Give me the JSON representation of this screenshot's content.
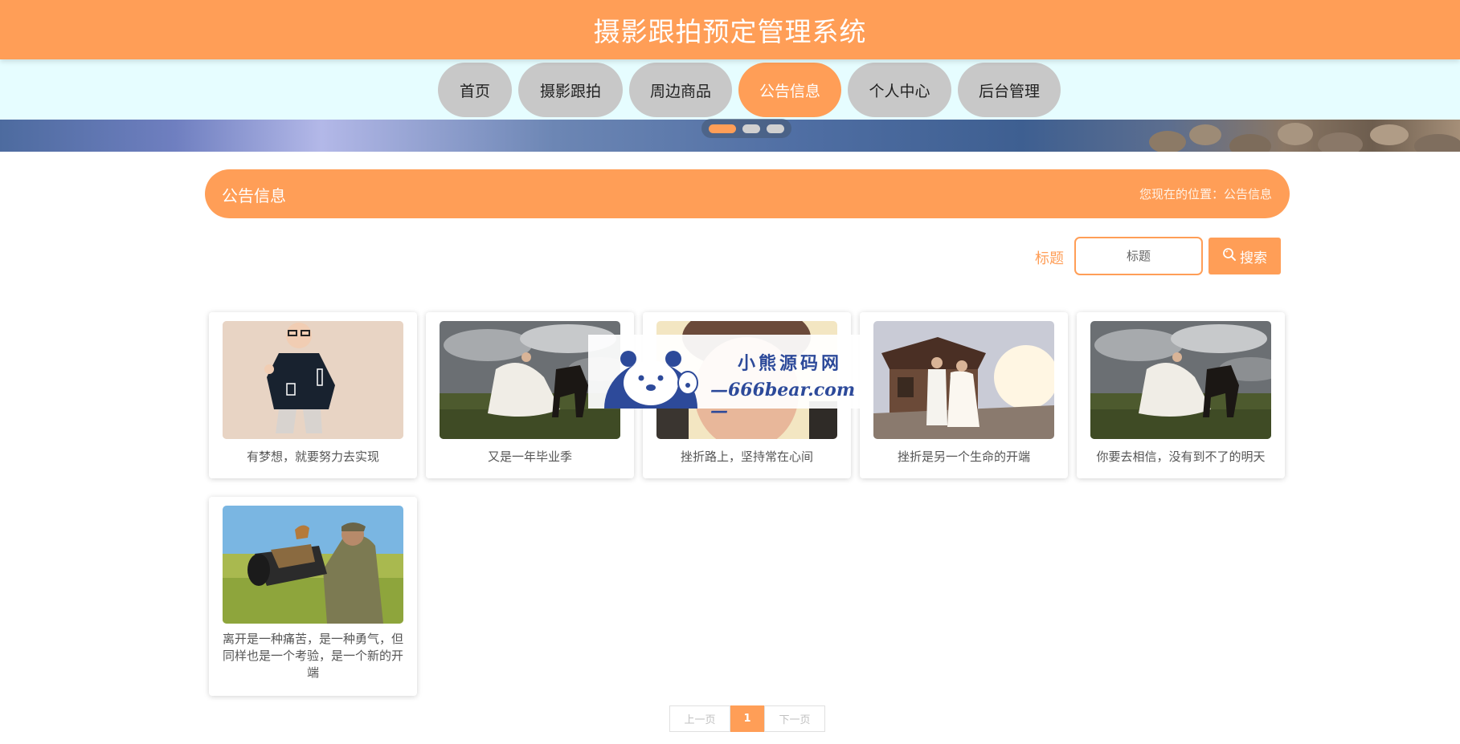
{
  "header": {
    "title": "摄影跟拍预定管理系统"
  },
  "nav": {
    "items": [
      {
        "label": "首页"
      },
      {
        "label": "摄影跟拍"
      },
      {
        "label": "周边商品"
      },
      {
        "label": "公告信息",
        "active": true
      },
      {
        "label": "个人中心"
      },
      {
        "label": "后台管理"
      }
    ]
  },
  "carousel": {
    "slide_count": 3,
    "active_index": 0
  },
  "section": {
    "title": "公告信息",
    "breadcrumb": "您现在的位置：公告信息"
  },
  "search": {
    "label": "标题",
    "placeholder": "标题",
    "button_label": "搜索",
    "icon": "search-icon"
  },
  "cards": [
    {
      "caption": "有梦想，就要努力去实现"
    },
    {
      "caption": "又是一年毕业季"
    },
    {
      "caption": "挫折路上，坚持常在心间"
    },
    {
      "caption": "挫折是另一个生命的开端"
    },
    {
      "caption": "你要去相信，没有到不了的明天"
    },
    {
      "caption": "离开是一种痛苦，是一种勇气，但同样也是一个考验，是一个新的开端"
    }
  ],
  "watermark": {
    "line1": "小熊源码网",
    "line2": "—666bear.com—"
  },
  "pagination": {
    "prev": "上一页",
    "current": "1",
    "next": "下一页"
  },
  "colors": {
    "accent": "#ff9e57",
    "nav_bg": "#e6fdff",
    "nav_inactive": "#c8c8c8"
  }
}
